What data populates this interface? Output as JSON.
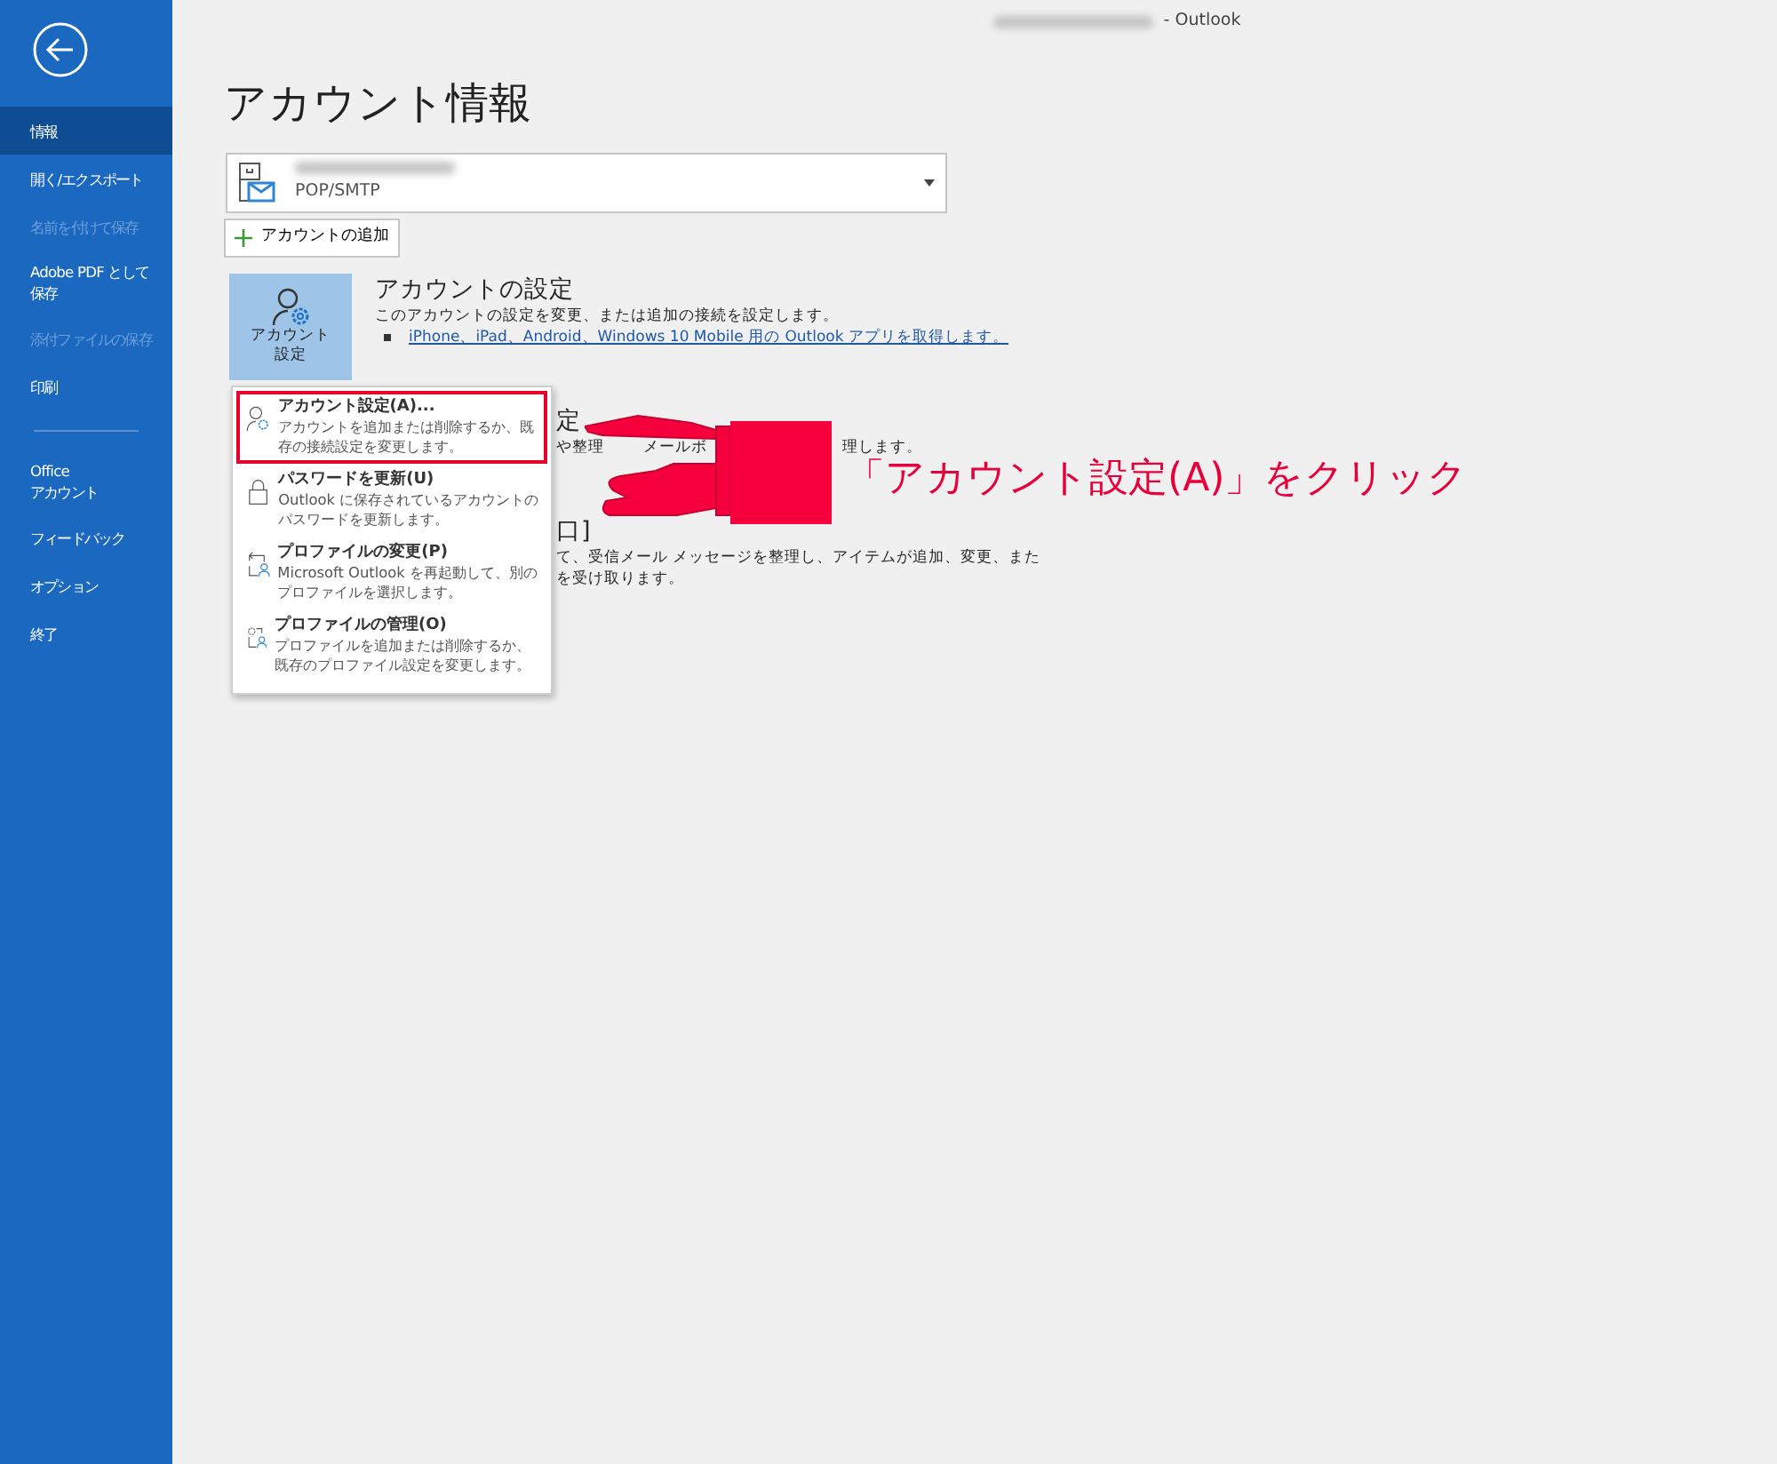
{
  "window": {
    "title": "-  Outlook",
    "email_redacted": true
  },
  "sidebar": {
    "items": [
      {
        "kind": "item",
        "label": "情報",
        "selected": true,
        "disabled": false
      },
      {
        "kind": "item",
        "label": "開く/エクスポート",
        "selected": false,
        "disabled": false
      },
      {
        "kind": "item",
        "label": "名前を付けて保存",
        "selected": false,
        "disabled": true
      },
      {
        "kind": "item",
        "lines": [
          "Adobe PDF として",
          "保存"
        ],
        "selected": false,
        "disabled": false
      },
      {
        "kind": "item",
        "label": "添付ファイルの保存",
        "selected": false,
        "disabled": true
      },
      {
        "kind": "item",
        "label": "印刷",
        "selected": false,
        "disabled": false
      },
      {
        "kind": "divider"
      },
      {
        "kind": "item",
        "lines": [
          "Office",
          "アカウント"
        ],
        "selected": false,
        "disabled": false
      },
      {
        "kind": "item",
        "label": "フィードバック",
        "selected": false,
        "disabled": false
      },
      {
        "kind": "item",
        "label": "オプション",
        "selected": false,
        "disabled": false
      },
      {
        "kind": "item",
        "label": "終了",
        "selected": false,
        "disabled": false
      }
    ]
  },
  "page_title": "アカウント情報",
  "account": {
    "email_redacted": true,
    "type": "POP/SMTP"
  },
  "add_account": "アカウントの追加",
  "sections": [
    {
      "tile_lines": [
        "アカウント",
        "設定"
      ],
      "heading": "アカウントの設定",
      "text": "このアカウントの設定を変更、または追加の接続を設定します。",
      "link": "iPhone、iPad、Android、Windows 10 Mobile 用の Outlook アプリを取得します。"
    },
    {
      "heading": "定",
      "text_parts": [
        "や整理",
        "メールボ",
        "理します。"
      ]
    },
    {
      "heading": "口]",
      "text_lines": [
        "て、受信メール メッセージを整理し、アイテムが追加、変更、また",
        "を受け取ります。"
      ]
    }
  ],
  "menu": {
    "items": [
      {
        "kind": "account",
        "title": "アカウント設定(A)...",
        "description": "アカウントを追加または削除するか、既存の接続設定を変更します。",
        "highlighted": true
      },
      {
        "kind": "lock",
        "title": "パスワードを更新(U)",
        "description": "Outlook に保存されているアカウントのパスワードを更新します。",
        "highlighted": false
      },
      {
        "kind": "switch",
        "title": "プロファイルの変更(P)",
        "description": "Microsoft Outlook を再起動して、別のプロファイルを選択します。",
        "highlighted": false
      },
      {
        "kind": "manage",
        "title": "プロファイルの管理(O)",
        "description": "プロファイルを追加または削除するか、既存のプロファイル設定を変更します。",
        "highlighted": false
      }
    ]
  },
  "annotation": {
    "text": "「アカウント設定(A)」をクリック"
  }
}
